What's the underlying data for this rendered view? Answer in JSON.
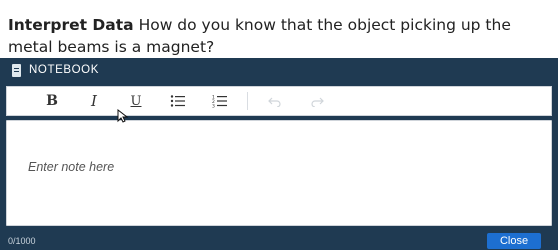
{
  "question": {
    "lead": "Interpret Data",
    "text": "How do you know that the object picking up the metal beams is a magnet?"
  },
  "notebook": {
    "title": "NOTEBOOK",
    "icon": "notebook-icon",
    "toolbar": {
      "bold_label": "B",
      "italic_label": "I",
      "underline_label": "U",
      "bulleted_list_icon": "bulleted-list-icon",
      "numbered_list_icon": "numbered-list-icon",
      "undo_icon": "undo-icon",
      "redo_icon": "redo-icon"
    },
    "editor": {
      "placeholder": "Enter note here",
      "value": ""
    },
    "char_count": "0/1000",
    "close_label": "Close"
  },
  "colors": {
    "header_bg": "#1f3a52",
    "close_button_bg": "#1d6fd1"
  }
}
